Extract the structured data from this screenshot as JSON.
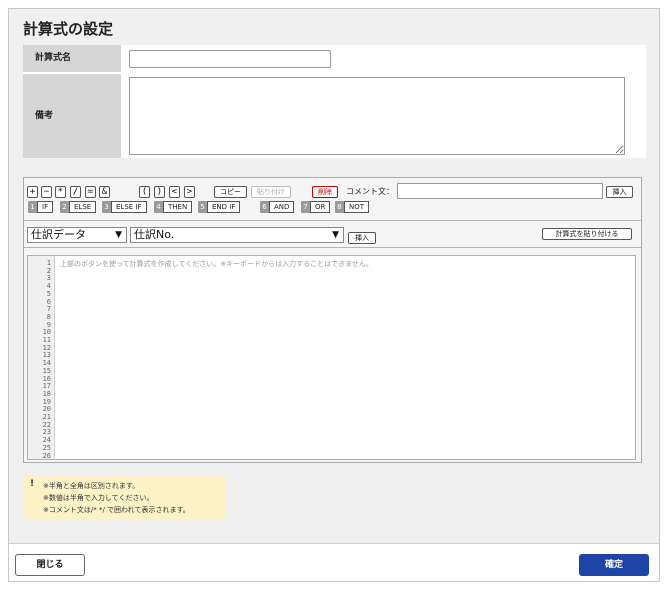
{
  "dialog": {
    "title": "計算式の設定"
  },
  "form": {
    "name_label": "計算式名",
    "name_value": "",
    "note_label": "備考",
    "note_value": ""
  },
  "toolbar": {
    "ops": [
      "+",
      "−",
      "*",
      "/",
      "=",
      "&"
    ],
    "parens": [
      "(",
      ")",
      "<",
      ">"
    ],
    "copy": "コピー",
    "paste": "貼り付け",
    "delete": "削除",
    "comment_label": "コメント文：",
    "comment_value": "",
    "insert": "挿入",
    "keywords": [
      {
        "num": "1",
        "word": "IF"
      },
      {
        "num": "2",
        "word": "ELSE"
      },
      {
        "num": "3",
        "word": "ELSE IF"
      },
      {
        "num": "4",
        "word": "THEN"
      },
      {
        "num": "5",
        "word": "END IF"
      },
      {
        "num": "6",
        "word": "AND"
      },
      {
        "num": "7",
        "word": "OR"
      },
      {
        "num": "8",
        "word": "NOT"
      }
    ]
  },
  "selectors": {
    "source": "仕訳データ",
    "field": "仕訳No.",
    "insert": "挿入",
    "paste_formula": "計算式を貼り付ける"
  },
  "code": {
    "placeholder": "上部のボタンを使って計算式を作成してください。※キーボードからは入力することはできません。",
    "line_count": 26
  },
  "notice": {
    "mark": "!",
    "lines": [
      "※半角と全角は区別されます。",
      "※数値は半角で入力してください。",
      "※コメント文は/* */ で囲われて表示されます。"
    ]
  },
  "footer": {
    "close": "閉じる",
    "confirm": "確定"
  },
  "colors": {
    "confirm_button": "#1e44a8",
    "delete_text": "#c00000",
    "notice_bg": "#fdf2c5"
  }
}
